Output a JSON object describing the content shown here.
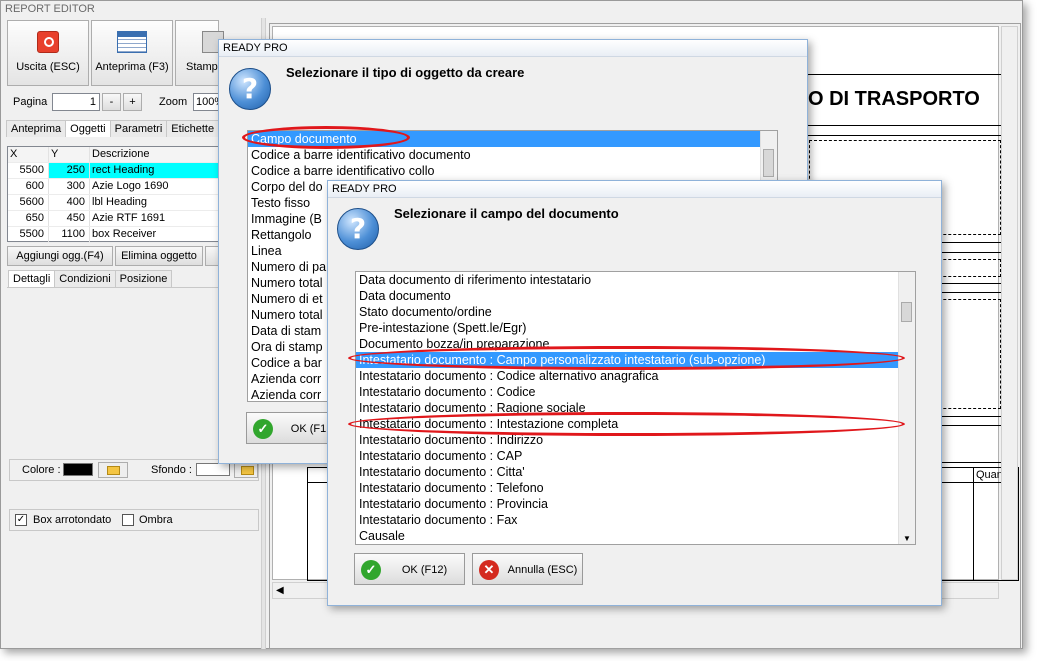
{
  "app": {
    "title": "REPORT EDITOR"
  },
  "toolbar": {
    "exit_label": "Uscita (ESC)",
    "preview_label": "Anteprima (F3)",
    "print_label": "Stamp"
  },
  "pager": {
    "page_label": "Pagina",
    "page_value": "1",
    "minus": "-",
    "plus": "+",
    "zoom_label": "Zoom",
    "zoom_value": "100%"
  },
  "left_tabs": [
    {
      "label": "Anteprima"
    },
    {
      "label": "Oggetti"
    },
    {
      "label": "Parametri"
    },
    {
      "label": "Etichette"
    }
  ],
  "objects_grid": {
    "headers": [
      "X",
      "Y",
      "Descrizione"
    ],
    "rows": [
      {
        "x": "5500",
        "y": "250",
        "desc": "rect Heading"
      },
      {
        "x": "600",
        "y": "300",
        "desc": "Azie Logo 1690"
      },
      {
        "x": "5600",
        "y": "400",
        "desc": "lbl Heading"
      },
      {
        "x": "650",
        "y": "450",
        "desc": "Azie RTF 1691"
      },
      {
        "x": "5500",
        "y": "1100",
        "desc": "box Receiver"
      }
    ]
  },
  "object_buttons": {
    "add": "Aggiungi ogg.(F4)",
    "delete": "Elimina oggetto"
  },
  "detail_tabs": [
    {
      "label": "Dettagli"
    },
    {
      "label": "Condizioni"
    },
    {
      "label": "Posizione"
    }
  ],
  "colors": {
    "color_label": "Colore :",
    "background_label": "Sfondo :",
    "accent": "#3399ff",
    "highlight_row": "#00ffff",
    "callout": "#e0171b"
  },
  "options": {
    "rounded_box": "Box arrotondato",
    "shadow": "Ombra",
    "rounded_checked": "✓"
  },
  "canvas": {
    "heading_text": "O DI TRASPORTO",
    "quant_label": "Quant."
  },
  "dialog1": {
    "title": "READY PRO",
    "prompt": "Selezionare il tipo di oggetto da creare",
    "items": [
      "Campo documento",
      "Codice a barre identificativo documento",
      "Codice a barre identificativo collo",
      "Corpo del do",
      "Testo fisso",
      "Immagine (B",
      "Rettangolo",
      "Linea",
      "Numero di pa",
      "Numero total",
      "Numero di et",
      "Numero total",
      "Data di stam",
      "Ora di stamp",
      "Codice a bar",
      "Azienda corr",
      "Azienda corr"
    ],
    "ok_label": "OK (F1"
  },
  "dialog2": {
    "title": "READY PRO",
    "prompt": "Selezionare il campo del documento",
    "items": [
      "Data documento di riferimento intestatario",
      "Data documento",
      "Stato documento/ordine",
      "Pre-intestazione (Spett.le/Egr)",
      "Documento bozza/in preparazione",
      "Intestatario documento : Campo personalizzato intestatario (sub-opzione)",
      "Intestatario documento : Codice alternativo anagrafica",
      "Intestatario documento : Codice",
      "Intestatario documento : Ragione sociale",
      "Intestatario documento : Intestazione completa",
      "Intestatario documento : Indirizzo",
      "Intestatario documento : CAP",
      "Intestatario documento : Citta'",
      "Intestatario documento : Telefono",
      "Intestatario documento : Provincia",
      "Intestatario documento : Fax",
      "Causale"
    ],
    "ok_label": "OK (F12)",
    "cancel_label": "Annulla (ESC)"
  },
  "icons": [
    "power-icon",
    "preview-icon",
    "printer-icon",
    "question-icon",
    "check-icon",
    "cross-icon",
    "folder-icon"
  ]
}
